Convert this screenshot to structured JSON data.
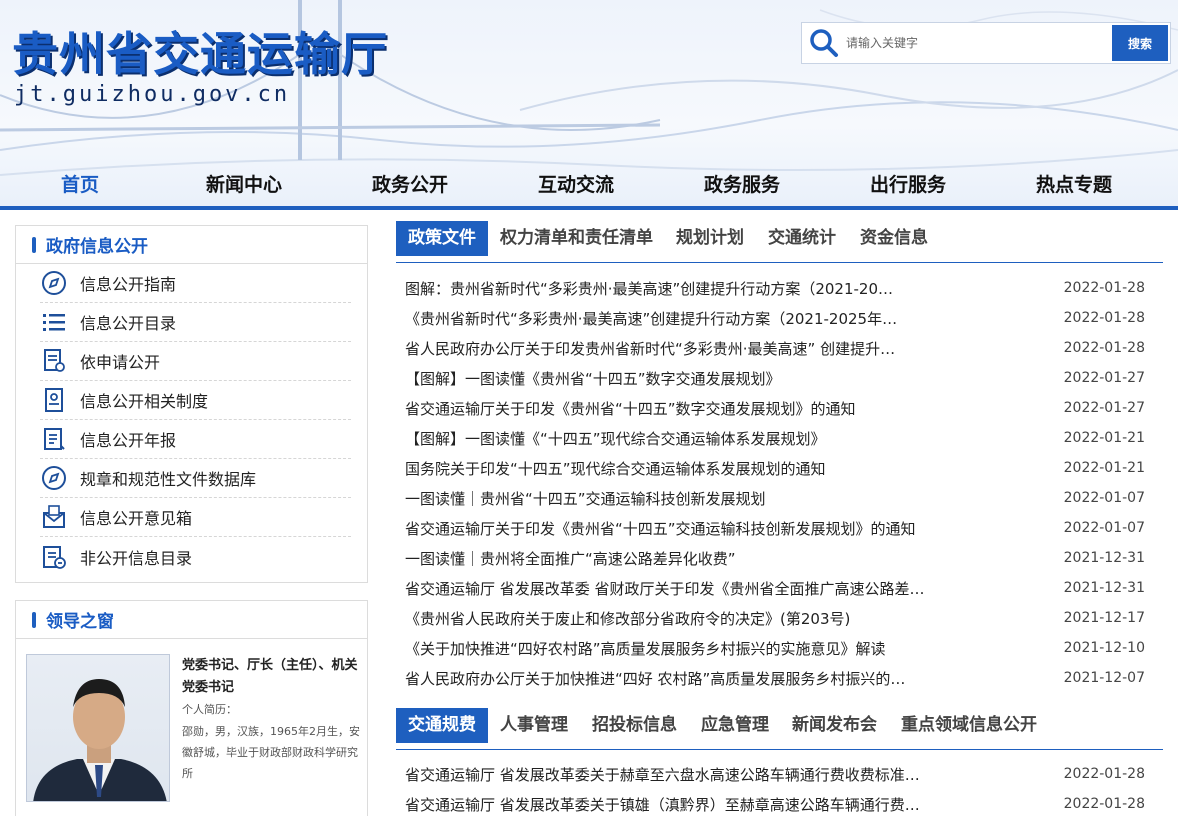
{
  "site": {
    "title": "贵州省交通运输厅",
    "url": "jt.guizhou.gov.cn"
  },
  "search": {
    "placeholder": "请输入关键字",
    "button": "搜索"
  },
  "nav": [
    "首页",
    "新闻中心",
    "政务公开",
    "互动交流",
    "政务服务",
    "出行服务",
    "热点专题"
  ],
  "info_panel": {
    "title": "政府信息公开",
    "items": [
      {
        "label": "信息公开指南",
        "icon": "compass-icon"
      },
      {
        "label": "信息公开目录",
        "icon": "list-icon"
      },
      {
        "label": "依申请公开",
        "icon": "apply-document-icon"
      },
      {
        "label": "信息公开相关制度",
        "icon": "regulation-icon"
      },
      {
        "label": "信息公开年报",
        "icon": "annual-report-icon"
      },
      {
        "label": "规章和规范性文件数据库",
        "icon": "compass-icon"
      },
      {
        "label": "信息公开意见箱",
        "icon": "mailbox-icon"
      },
      {
        "label": "非公开信息目录",
        "icon": "restricted-list-icon"
      }
    ]
  },
  "leader_panel": {
    "title": "领导之窗",
    "position": "党委书记、厅长（主任）、机关党委书记",
    "bio_label": "个人简历：",
    "bio": "邵勋，男，汉族，1965年2月生，安徽舒城，毕业于财政部财政科学研究所"
  },
  "tabs1": {
    "items": [
      "政策文件",
      "权力清单和责任清单",
      "规划计划",
      "交通统计",
      "资金信息"
    ],
    "active": 0,
    "news": [
      {
        "title": "图解：贵州省新时代“多彩贵州·最美高速”创建提升行动方案（2021-20…",
        "date": "2022-01-28"
      },
      {
        "title": "《贵州省新时代“多彩贵州·最美高速”创建提升行动方案（2021-2025年…",
        "date": "2022-01-28"
      },
      {
        "title": "省人民政府办公厅关于印发贵州省新时代“多彩贵州·最美高速” 创建提升…",
        "date": "2022-01-28"
      },
      {
        "title": "【图解】一图读懂《贵州省“十四五”数字交通发展规划》",
        "date": "2022-01-27"
      },
      {
        "title": "省交通运输厅关于印发《贵州省“十四五”数字交通发展规划》的通知",
        "date": "2022-01-27"
      },
      {
        "title": "【图解】一图读懂《“十四五”现代综合交通运输体系发展规划》",
        "date": "2022-01-21"
      },
      {
        "title": "国务院关于印发“十四五”现代综合交通运输体系发展规划的通知",
        "date": "2022-01-21"
      },
      {
        "title": "一图读懂｜贵州省“十四五”交通运输科技创新发展规划",
        "date": "2022-01-07"
      },
      {
        "title": "省交通运输厅关于印发《贵州省“十四五”交通运输科技创新发展规划》的通知",
        "date": "2022-01-07"
      },
      {
        "title": "一图读懂｜贵州将全面推广“高速公路差异化收费”",
        "date": "2021-12-31"
      },
      {
        "title": "省交通运输厅 省发展改革委 省财政厅关于印发《贵州省全面推广高速公路差…",
        "date": "2021-12-31"
      },
      {
        "title": "《贵州省人民政府关于废止和修改部分省政府令的决定》(第203号)",
        "date": "2021-12-17"
      },
      {
        "title": "《关于加快推进“四好农村路”高质量发展服务乡村振兴的实施意见》解读",
        "date": "2021-12-10"
      },
      {
        "title": "省人民政府办公厅关于加快推进“四好 农村路”高质量发展服务乡村振兴的…",
        "date": "2021-12-07"
      }
    ]
  },
  "tabs2": {
    "items": [
      "交通规费",
      "人事管理",
      "招投标信息",
      "应急管理",
      "新闻发布会",
      "重点领域信息公开"
    ],
    "active": 0,
    "news": [
      {
        "title": "省交通运输厅 省发展改革委关于赫章至六盘水高速公路车辆通行费收费标准…",
        "date": "2022-01-28"
      },
      {
        "title": "省交通运输厅 省发展改革委关于镇雄（滇黔界）至赫章高速公路车辆通行费…",
        "date": "2022-01-28"
      }
    ]
  },
  "colors": {
    "brand": "#1e5fbf",
    "title_shadow": "#0b2f6e"
  }
}
